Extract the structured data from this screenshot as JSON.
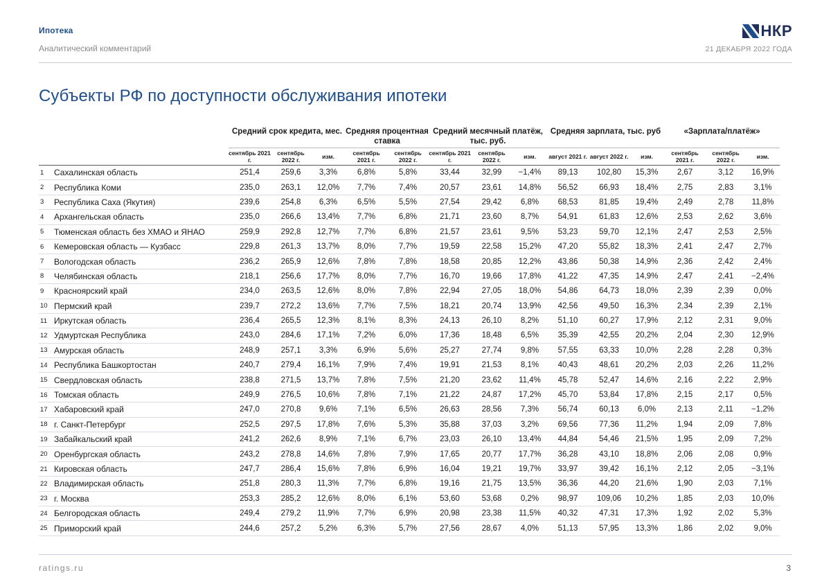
{
  "header": {
    "section": "Ипотека",
    "subtitle": "Аналитический комментарий",
    "logo_text": "НКР",
    "date": "21 ДЕКАБРЯ 2022 ГОДА"
  },
  "title": "Субъекты РФ по доступности обслуживания ипотеки",
  "table": {
    "groups": [
      "Средний срок кредита, мес.",
      "Средняя процентная ставка",
      "Средний месячный платёж, тыс. руб.",
      "Средняя зарплата, тыс. руб",
      "«Зарплата/платёж»"
    ],
    "subheaders": [
      [
        "сентябрь 2021 г.",
        "сентябрь 2022 г.",
        "изм."
      ],
      [
        "сентябрь 2021 г.",
        "сентябрь 2022 г."
      ],
      [
        "сентябрь 2021 г.",
        "сентябрь 2022 г.",
        "изм."
      ],
      [
        "август 2021 г.",
        "август 2022 г.",
        "изм."
      ],
      [
        "сентябрь 2021 г.",
        "сентябрь 2022 г.",
        "изм."
      ]
    ],
    "rows": [
      [
        "1",
        "Сахалинская область",
        "251,4",
        "259,6",
        "3,3%",
        "6,8%",
        "5,8%",
        "33,44",
        "32,99",
        "−1,4%",
        "89,13",
        "102,80",
        "15,3%",
        "2,67",
        "3,12",
        "16,9%"
      ],
      [
        "2",
        "Республика Коми",
        "235,0",
        "263,1",
        "12,0%",
        "7,7%",
        "7,4%",
        "20,57",
        "23,61",
        "14,8%",
        "56,52",
        "66,93",
        "18,4%",
        "2,75",
        "2,83",
        "3,1%"
      ],
      [
        "3",
        "Республика Саха (Якутия)",
        "239,6",
        "254,8",
        "6,3%",
        "6,5%",
        "5,5%",
        "27,54",
        "29,42",
        "6,8%",
        "68,53",
        "81,85",
        "19,4%",
        "2,49",
        "2,78",
        "11,8%"
      ],
      [
        "4",
        "Архангельская область",
        "235,0",
        "266,6",
        "13,4%",
        "7,7%",
        "6,8%",
        "21,71",
        "23,60",
        "8,7%",
        "54,91",
        "61,83",
        "12,6%",
        "2,53",
        "2,62",
        "3,6%"
      ],
      [
        "5",
        "Тюменская область без ХМАО и ЯНАО",
        "259,9",
        "292,8",
        "12,7%",
        "7,7%",
        "6,8%",
        "21,57",
        "23,61",
        "9,5%",
        "53,23",
        "59,70",
        "12,1%",
        "2,47",
        "2,53",
        "2,5%"
      ],
      [
        "6",
        "Кемеровская область — Кузбасс",
        "229,8",
        "261,3",
        "13,7%",
        "8,0%",
        "7,7%",
        "19,59",
        "22,58",
        "15,2%",
        "47,20",
        "55,82",
        "18,3%",
        "2,41",
        "2,47",
        "2,7%"
      ],
      [
        "7",
        "Вологодская область",
        "236,2",
        "265,9",
        "12,6%",
        "7,8%",
        "7,8%",
        "18,58",
        "20,85",
        "12,2%",
        "43,86",
        "50,38",
        "14,9%",
        "2,36",
        "2,42",
        "2,4%"
      ],
      [
        "8",
        "Челябинская область",
        "218,1",
        "256,6",
        "17,7%",
        "8,0%",
        "7,7%",
        "16,70",
        "19,66",
        "17,8%",
        "41,22",
        "47,35",
        "14,9%",
        "2,47",
        "2,41",
        "−2,4%"
      ],
      [
        "9",
        "Красноярский край",
        "234,0",
        "263,5",
        "12,6%",
        "8,0%",
        "7,8%",
        "22,94",
        "27,05",
        "18,0%",
        "54,86",
        "64,73",
        "18,0%",
        "2,39",
        "2,39",
        "0,0%"
      ],
      [
        "10",
        "Пермский край",
        "239,7",
        "272,2",
        "13,6%",
        "7,7%",
        "7,5%",
        "18,21",
        "20,74",
        "13,9%",
        "42,56",
        "49,50",
        "16,3%",
        "2,34",
        "2,39",
        "2,1%"
      ],
      [
        "11",
        "Иркутская область",
        "236,4",
        "265,5",
        "12,3%",
        "8,1%",
        "8,3%",
        "24,13",
        "26,10",
        "8,2%",
        "51,10",
        "60,27",
        "17,9%",
        "2,12",
        "2,31",
        "9,0%"
      ],
      [
        "12",
        "Удмуртская Республика",
        "243,0",
        "284,6",
        "17,1%",
        "7,2%",
        "6,0%",
        "17,36",
        "18,48",
        "6,5%",
        "35,39",
        "42,55",
        "20,2%",
        "2,04",
        "2,30",
        "12,9%"
      ],
      [
        "13",
        "Амурская область",
        "248,9",
        "257,1",
        "3,3%",
        "6,9%",
        "5,6%",
        "25,27",
        "27,74",
        "9,8%",
        "57,55",
        "63,33",
        "10,0%",
        "2,28",
        "2,28",
        "0,3%"
      ],
      [
        "14",
        "Республика Башкортостан",
        "240,7",
        "279,4",
        "16,1%",
        "7,9%",
        "7,4%",
        "19,91",
        "21,53",
        "8,1%",
        "40,43",
        "48,61",
        "20,2%",
        "2,03",
        "2,26",
        "11,2%"
      ],
      [
        "15",
        "Свердловская область",
        "238,8",
        "271,5",
        "13,7%",
        "7,8%",
        "7,5%",
        "21,20",
        "23,62",
        "11,4%",
        "45,78",
        "52,47",
        "14,6%",
        "2,16",
        "2,22",
        "2,9%"
      ],
      [
        "16",
        "Томская область",
        "249,9",
        "276,5",
        "10,6%",
        "7,8%",
        "7,1%",
        "21,22",
        "24,87",
        "17,2%",
        "45,70",
        "53,84",
        "17,8%",
        "2,15",
        "2,17",
        "0,5%"
      ],
      [
        "17",
        "Хабаровский край",
        "247,0",
        "270,8",
        "9,6%",
        "7,1%",
        "6,5%",
        "26,63",
        "28,56",
        "7,3%",
        "56,74",
        "60,13",
        "6,0%",
        "2,13",
        "2,11",
        "−1,2%"
      ],
      [
        "18",
        "г. Санкт-Петербург",
        "252,5",
        "297,5",
        "17,8%",
        "7,6%",
        "5,3%",
        "35,88",
        "37,03",
        "3,2%",
        "69,56",
        "77,36",
        "11,2%",
        "1,94",
        "2,09",
        "7,8%"
      ],
      [
        "19",
        "Забайкальский край",
        "241,2",
        "262,6",
        "8,9%",
        "7,1%",
        "6,7%",
        "23,03",
        "26,10",
        "13,4%",
        "44,84",
        "54,46",
        "21,5%",
        "1,95",
        "2,09",
        "7,2%"
      ],
      [
        "20",
        "Оренбургская область",
        "243,2",
        "278,8",
        "14,6%",
        "7,8%",
        "7,9%",
        "17,65",
        "20,77",
        "17,7%",
        "36,28",
        "43,10",
        "18,8%",
        "2,06",
        "2,08",
        "0,9%"
      ],
      [
        "21",
        "Кировская область",
        "247,7",
        "286,4",
        "15,6%",
        "7,8%",
        "6,9%",
        "16,04",
        "19,21",
        "19,7%",
        "33,97",
        "39,42",
        "16,1%",
        "2,12",
        "2,05",
        "−3,1%"
      ],
      [
        "22",
        "Владимирская область",
        "251,8",
        "280,3",
        "11,3%",
        "7,7%",
        "6,8%",
        "19,16",
        "21,75",
        "13,5%",
        "36,36",
        "44,20",
        "21,6%",
        "1,90",
        "2,03",
        "7,1%"
      ],
      [
        "23",
        "г. Москва",
        "253,3",
        "285,2",
        "12,6%",
        "8,0%",
        "6,1%",
        "53,60",
        "53,68",
        "0,2%",
        "98,97",
        "109,06",
        "10,2%",
        "1,85",
        "2,03",
        "10,0%"
      ],
      [
        "24",
        "Белгородская область",
        "249,4",
        "279,2",
        "11,9%",
        "7,7%",
        "6,9%",
        "20,98",
        "23,38",
        "11,5%",
        "40,32",
        "47,31",
        "17,3%",
        "1,92",
        "2,02",
        "5,3%"
      ],
      [
        "25",
        "Приморский край",
        "244,6",
        "257,2",
        "5,2%",
        "6,3%",
        "5,7%",
        "27,56",
        "28,67",
        "4,0%",
        "51,13",
        "57,95",
        "13,3%",
        "1,86",
        "2,02",
        "9,0%"
      ]
    ]
  },
  "footer": {
    "site": "ratings.ru",
    "page": "3"
  },
  "colors": {
    "accent": "#1f4e8c",
    "logo_dark": "#1f2f5a",
    "muted": "#8a8a8a"
  }
}
